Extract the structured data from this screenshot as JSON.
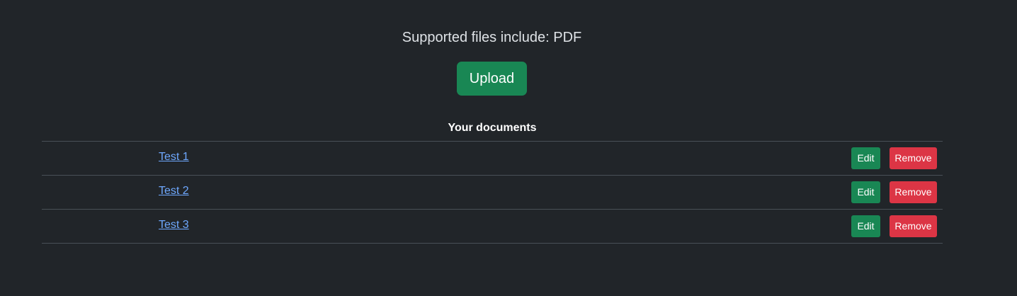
{
  "upload_section": {
    "supported_text": "Supported files include: PDF",
    "upload_label": "Upload"
  },
  "documents": {
    "header": "Your documents",
    "rows": [
      {
        "name": "Test 1",
        "edit_label": "Edit",
        "remove_label": "Remove"
      },
      {
        "name": "Test 2",
        "edit_label": "Edit",
        "remove_label": "Remove"
      },
      {
        "name": "Test 3",
        "edit_label": "Edit",
        "remove_label": "Remove"
      }
    ]
  },
  "colors": {
    "background": "#212529",
    "success": "#198754",
    "danger": "#dc3545",
    "link": "#6ea8fe",
    "divider": "#495057"
  }
}
